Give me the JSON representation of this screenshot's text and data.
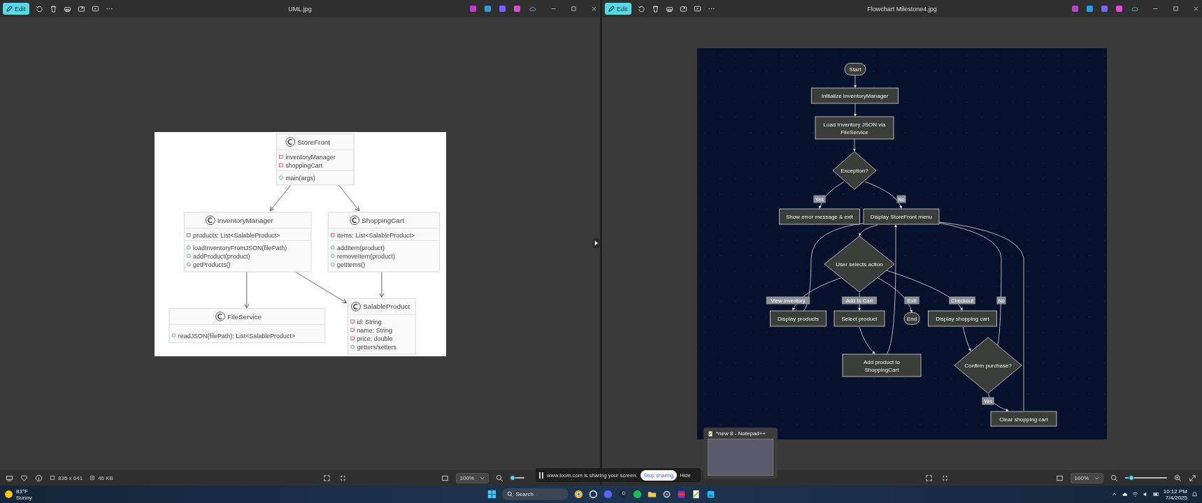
{
  "left_viewer": {
    "edit_button": "Edit",
    "title": "UML.jpg",
    "info": [
      "835 x 641",
      "46 KB"
    ],
    "zoom": "100%",
    "zoom_slider": {
      "level": 0.15
    },
    "uml": {
      "classes": [
        {
          "name": "StoreFront",
          "attributes": [
            {
              "kind": "private",
              "text": "inventoryManager"
            },
            {
              "kind": "private",
              "text": "shoppingCart"
            }
          ],
          "methods": [
            {
              "kind": "public",
              "text": "main(args)"
            }
          ]
        },
        {
          "name": "InventoryManager",
          "attributes": [
            {
              "kind": "private",
              "text": "products: List<SalableProduct>"
            }
          ],
          "methods": [
            {
              "kind": "public",
              "text": "loadInventoryFromJSON(filePath)"
            },
            {
              "kind": "public",
              "text": "addProduct(product)"
            },
            {
              "kind": "public",
              "text": "getProducts()"
            }
          ]
        },
        {
          "name": "ShoppingCart",
          "attributes": [
            {
              "kind": "private",
              "text": "items: List<SalableProduct>"
            }
          ],
          "methods": [
            {
              "kind": "public",
              "text": "addItem(product)"
            },
            {
              "kind": "public",
              "text": "removeItem(product)"
            },
            {
              "kind": "public",
              "text": "getItems()"
            }
          ]
        },
        {
          "name": "FileService",
          "methods": [
            {
              "kind": "public",
              "text": "readJSON(filePath): List<SalableProduct>"
            }
          ]
        },
        {
          "name": "SalableProduct",
          "attributes": [
            {
              "kind": "private",
              "text": "id: String"
            },
            {
              "kind": "private",
              "text": "name: String"
            },
            {
              "kind": "private",
              "text": "price: double"
            },
            {
              "kind": "public",
              "text": "getters/setters"
            }
          ]
        }
      ]
    }
  },
  "right_viewer": {
    "edit_button": "Edit",
    "title": "Flowchart Milestone4.jpg",
    "zoom": "100%",
    "zoom_slider": {
      "level": 0.15
    },
    "flowchart": {
      "nodes": [
        {
          "kind": "terminal",
          "lines": [
            "Start"
          ]
        },
        {
          "kind": "process",
          "lines": [
            "Initialize InventoryManager"
          ]
        },
        {
          "kind": "process",
          "lines": [
            "Load Inventory JSON via",
            "FileService"
          ]
        },
        {
          "kind": "decision",
          "lines": [
            "Exception?"
          ]
        },
        {
          "kind": "process",
          "lines": [
            "Show error message & exit"
          ]
        },
        {
          "kind": "process",
          "lines": [
            "Display StoreFront menu"
          ]
        },
        {
          "kind": "decision",
          "lines": [
            "User selects action"
          ]
        },
        {
          "kind": "process",
          "lines": [
            "Display products"
          ]
        },
        {
          "kind": "process",
          "lines": [
            "Select product"
          ]
        },
        {
          "kind": "terminal",
          "lines": [
            "End"
          ]
        },
        {
          "kind": "process",
          "lines": [
            "Display shopping cart"
          ]
        },
        {
          "kind": "process",
          "lines": [
            "Add product to",
            "ShoppingCart"
          ]
        },
        {
          "kind": "decision",
          "lines": [
            "Confirm purchase?"
          ]
        },
        {
          "kind": "process",
          "lines": [
            "Clear shopping cart"
          ]
        }
      ],
      "edge_labels": [
        "Yes",
        "No",
        "View inventory",
        "Add to Cart",
        "Exit",
        "Checkout",
        "No",
        "Yes"
      ]
    }
  },
  "screen_share_banner": {
    "message": "www.loom.com is sharing your screen.",
    "stop_button": "Stop sharing",
    "hide_button": "Hide"
  },
  "taskbar_preview": {
    "title": "*new 8 - Notepad++"
  },
  "taskbar": {
    "weather": {
      "temperature": "83°F",
      "condition": "Sunny"
    },
    "search": {
      "placeholder": "Search"
    },
    "time": "10:12 PM",
    "date": "7/4/2025"
  }
}
